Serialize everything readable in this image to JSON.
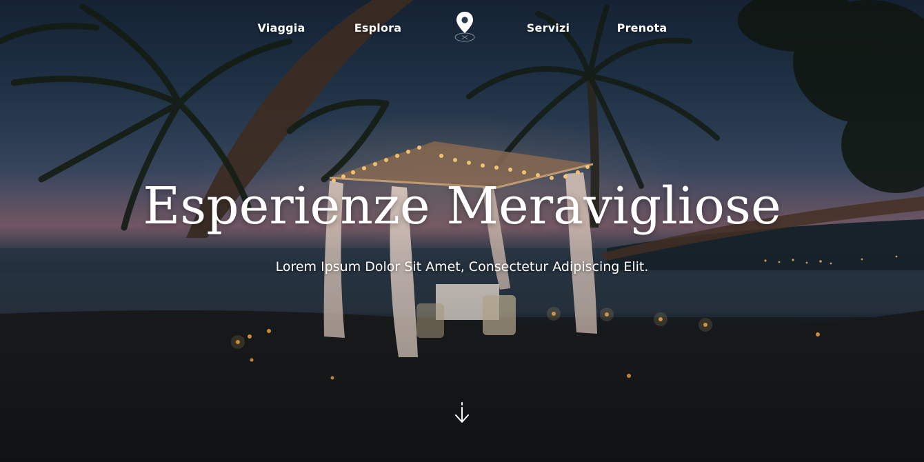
{
  "nav": {
    "items": [
      {
        "label": "Viaggia"
      },
      {
        "label": "Esplora"
      },
      {
        "label": "Servizi"
      },
      {
        "label": "Prenota"
      }
    ],
    "logo_icon": "map-pin-icon"
  },
  "hero": {
    "title": "Esperienze Meravigliose",
    "subtitle": "Lorem Ipsum Dolor Sit Amet, Consectetur Adipiscing Elit.",
    "scroll_icon": "arrow-down-icon"
  },
  "colors": {
    "text": "#ffffff",
    "sky_top": "#18283c",
    "horizon_glow": "#7c5f6d",
    "ground": "#14171a",
    "lights": "#ffcf7a"
  }
}
